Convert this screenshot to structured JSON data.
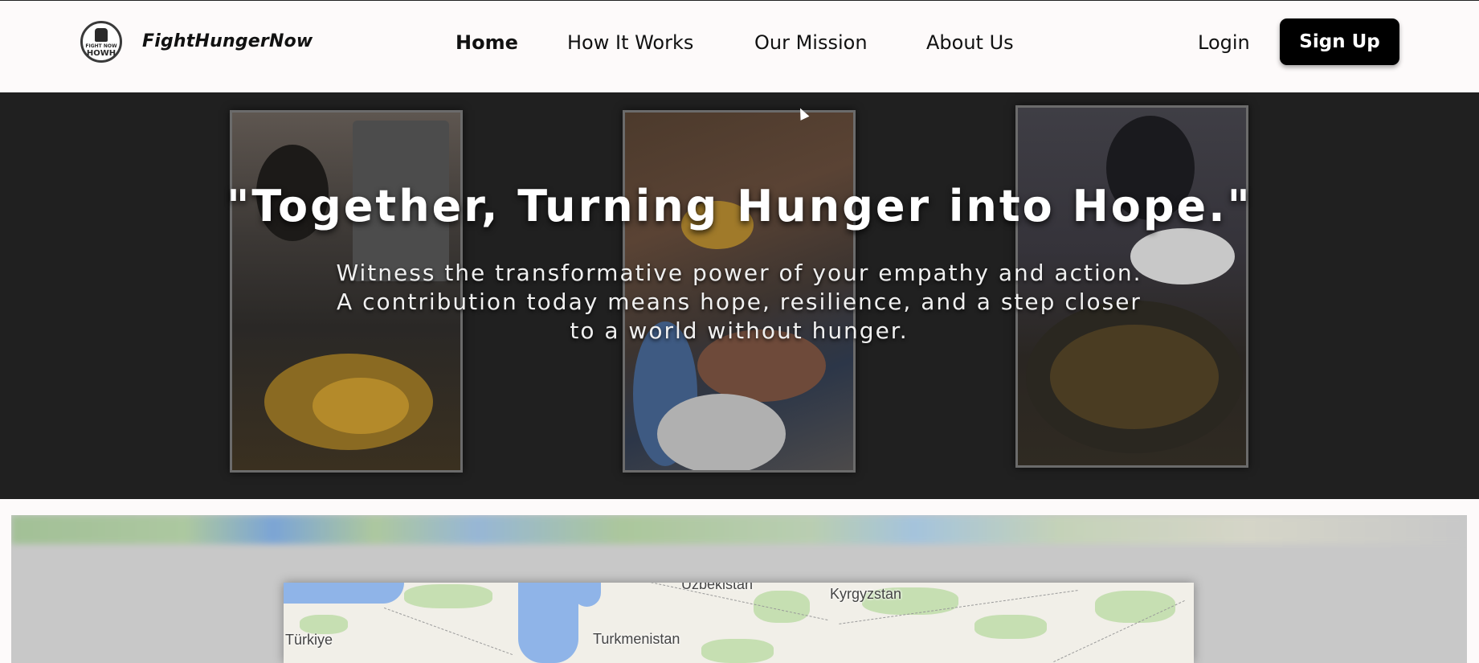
{
  "header": {
    "logo": {
      "line1": "FIGHT NOW",
      "line2": "HOWH",
      "icon": "fist-icon"
    },
    "brand": "FightHungerNow",
    "nav": [
      "Home",
      "How It Works",
      "Our Mission",
      "About Us"
    ],
    "active_nav": "Home",
    "login_label": "Login",
    "signup_label": "Sign Up"
  },
  "hero": {
    "title": "\"Together, Turning Hunger into Hope.\"",
    "subtitle": "Witness the transformative power of your empathy and action. A contribution today means hope, resilience, and a step closer to a world without hunger."
  },
  "map": {
    "labels": [
      "Uzbekistan",
      "Kyrgyzstan",
      "Türkiye",
      "Turkmenistan"
    ]
  },
  "colors": {
    "header_bg": "#fdfafa",
    "hero_bg": "#202020",
    "button_bg": "#000000",
    "map_section_bg": "#c8c8c8"
  }
}
